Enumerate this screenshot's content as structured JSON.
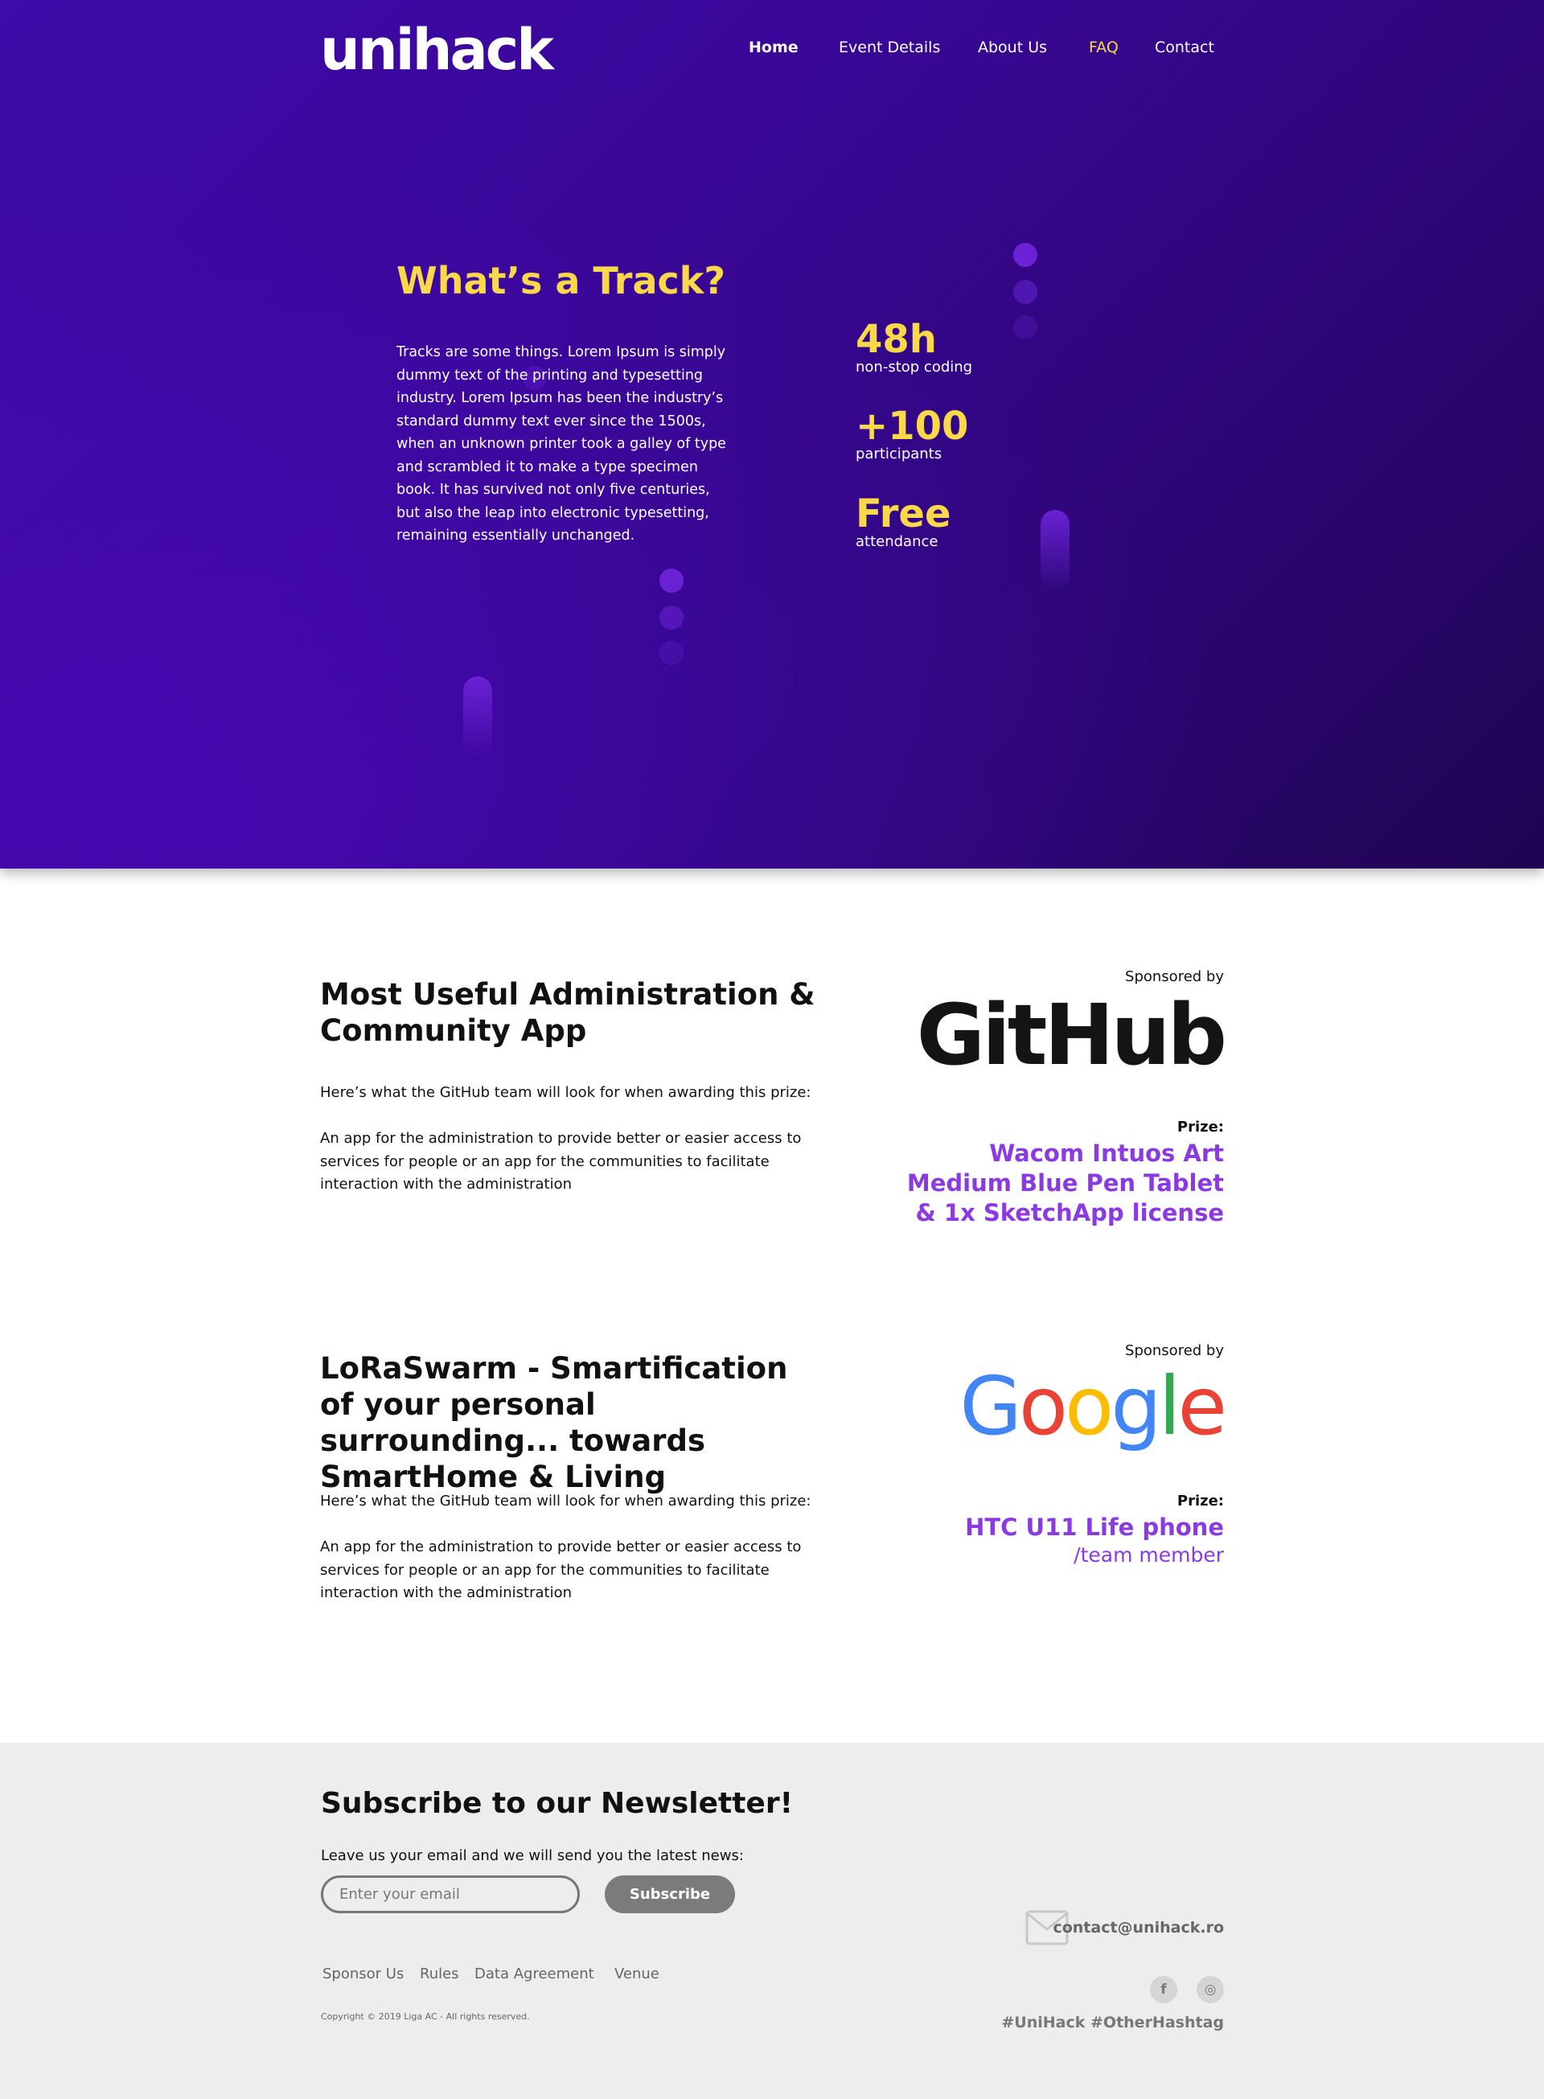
{
  "header": {
    "logo": "unihack",
    "nav": [
      {
        "label": "Home"
      },
      {
        "label": "Event Details"
      },
      {
        "label": "About Us"
      },
      {
        "label": "FAQ"
      },
      {
        "label": "Contact"
      }
    ],
    "active_item": "Home",
    "highlighted_item": "FAQ"
  },
  "hero": {
    "title": "What’s a Track?",
    "body": "Tracks are some things. Lorem Ipsum is simply dummy text of the printing and typesetting industry. Lorem Ipsum has been the industry’s standard dummy text ever since the 1500s, when an unknown printer took a galley of type and scrambled it to make a type specimen book. It has survived not only five centuries, but also the leap into electronic typesetting, remaining essentially unchanged.",
    "stats": [
      {
        "value": "48h",
        "label": "non-stop coding"
      },
      {
        "value": "+100",
        "label": "participants"
      },
      {
        "value": "Free",
        "label": "attendance"
      }
    ]
  },
  "tracks": [
    {
      "title": "Most Useful Administration & Community App",
      "intro": "Here’s what the GitHub team will look for when awarding this prize:",
      "description": "An app for the administration to provide better or easier access to services for people or an app for the communities to facilitate interaction with the administration",
      "sponsored_by": "Sponsored by",
      "sponsor": "GitHub",
      "prize_label": "Prize:",
      "prize": "Wacom Intuos Art Medium Blue Pen Tablet & 1x SketchApp license",
      "prize_sub": ""
    },
    {
      "title": "LoRaSwarm - Smartification of your personal surrounding... towards SmartHome & Living",
      "intro": "Here’s what the GitHub team will look for when awarding this prize:",
      "description": "An app for the administration to provide better or easier access to services for people or an app for the communities to facilitate interaction with the administration",
      "sponsored_by": "Sponsored by",
      "sponsor": "Google",
      "prize_label": "Prize:",
      "prize": "HTC U11 Life phone",
      "prize_sub": "/team member"
    }
  ],
  "footer": {
    "newsletter_title": "Subscribe to our Newsletter!",
    "newsletter_text": "Leave us your email and we will send you the latest news:",
    "email_placeholder": "Enter your email",
    "subscribe_label": "Subscribe",
    "links": [
      "Sponsor Us",
      "Rules",
      "Data Agreement",
      "Venue"
    ],
    "copyright": "Copyright © 2019 Liga AC - All rights reserved.",
    "contact_email": "contact@unihack.ro",
    "socials": [
      {
        "icon": "facebook-icon",
        "glyph": "f"
      },
      {
        "icon": "instagram-icon",
        "glyph": "◎"
      }
    ],
    "hashtags": "#UniHack #OtherHashtag"
  },
  "colors": {
    "hero_purple": "#3a0799",
    "accent_yellow": "#f9d84a",
    "prize_purple": "#8a3ae0",
    "footer_gray": "#ededed"
  }
}
